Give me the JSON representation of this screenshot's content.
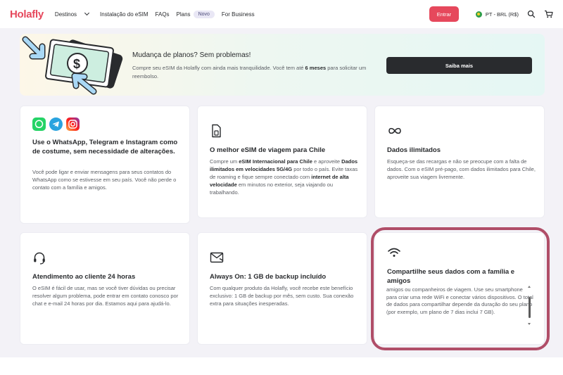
{
  "header": {
    "logo": "Holafly",
    "nav": [
      {
        "label": "Destinos"
      },
      {
        "label": "Instalação do eSIM"
      },
      {
        "label": "FAQs"
      },
      {
        "label": "Plans"
      },
      {
        "label": "For Business"
      }
    ],
    "plans_badge": "Novo",
    "enter_label": "Entrar",
    "language": "PT - BRL (R$)"
  },
  "banner": {
    "title": "Mudança de planos? Sem problemas!",
    "text_before": "Compre seu eSIM da Holafly com ainda mais tranquilidade. Você tem até ",
    "text_bold": "6 meses",
    "text_after": " para solicitar um reembolso.",
    "button_label": "Saiba mais"
  },
  "cards": {
    "social": {
      "title": "Use o WhatsApp, Telegram e Instagram como de costume, sem necessidade de alterações.",
      "text": "Você pode ligar e enviar mensagens para seus contatos do WhatsApp como se estivesse em seu país. Você não perde o contato com a família e amigos."
    },
    "best": {
      "title": "O melhor eSIM de viagem para Chile",
      "t1": "Compre um ",
      "b1": "eSIM Internacional para Chile",
      "t2": " e aproveite ",
      "b2": "Dados ilimitados em velocidades 5G/4G",
      "t3": " por todo o país. Evite taxas de roaming e fique sempre conectado com ",
      "b3": "internet de alta velocidade",
      "t4": " em minutos no exterior, seja viajando ou trabalhando."
    },
    "unlimited": {
      "title": "Dados ilimitados",
      "text": "Esqueça-se das recargas e não se preocupe com a falta de dados. Com o eSIM pré-pago, com dados ilimitados para Chile, aproveite sua viagem livremente."
    },
    "support": {
      "title": "Atendimento ao cliente 24 horas",
      "text": "O eSIM é fácil de usar, mas se você tiver dúvidas ou precisar resolver algum problema, pode entrar em contato conosco por chat e e-mail 24 horas por dia. Estamos aqui para ajudá-lo."
    },
    "always_on": {
      "title": "Always On: 1 GB de backup incluído",
      "text": "Com qualquer produto da Holafly, você recebe este benefício exclusivo: 1 GB de backup por mês, sem custo. Sua conexão extra para situações inesperadas."
    },
    "share": {
      "title": "Compartilhe seus dados com a família e amigos",
      "text": "amigos ou companheiros de viagem. Use seu smartphone para criar uma rede WiFi e conectar vários dispositivos. O total de dados para compartilhar depende da duração do seu plano (por exemplo, um plano de 7 dias inclui 7 GB)."
    }
  },
  "colors": {
    "brand": "#e6485c",
    "highlight": "#b04e68",
    "dark_button": "#292b2e"
  }
}
